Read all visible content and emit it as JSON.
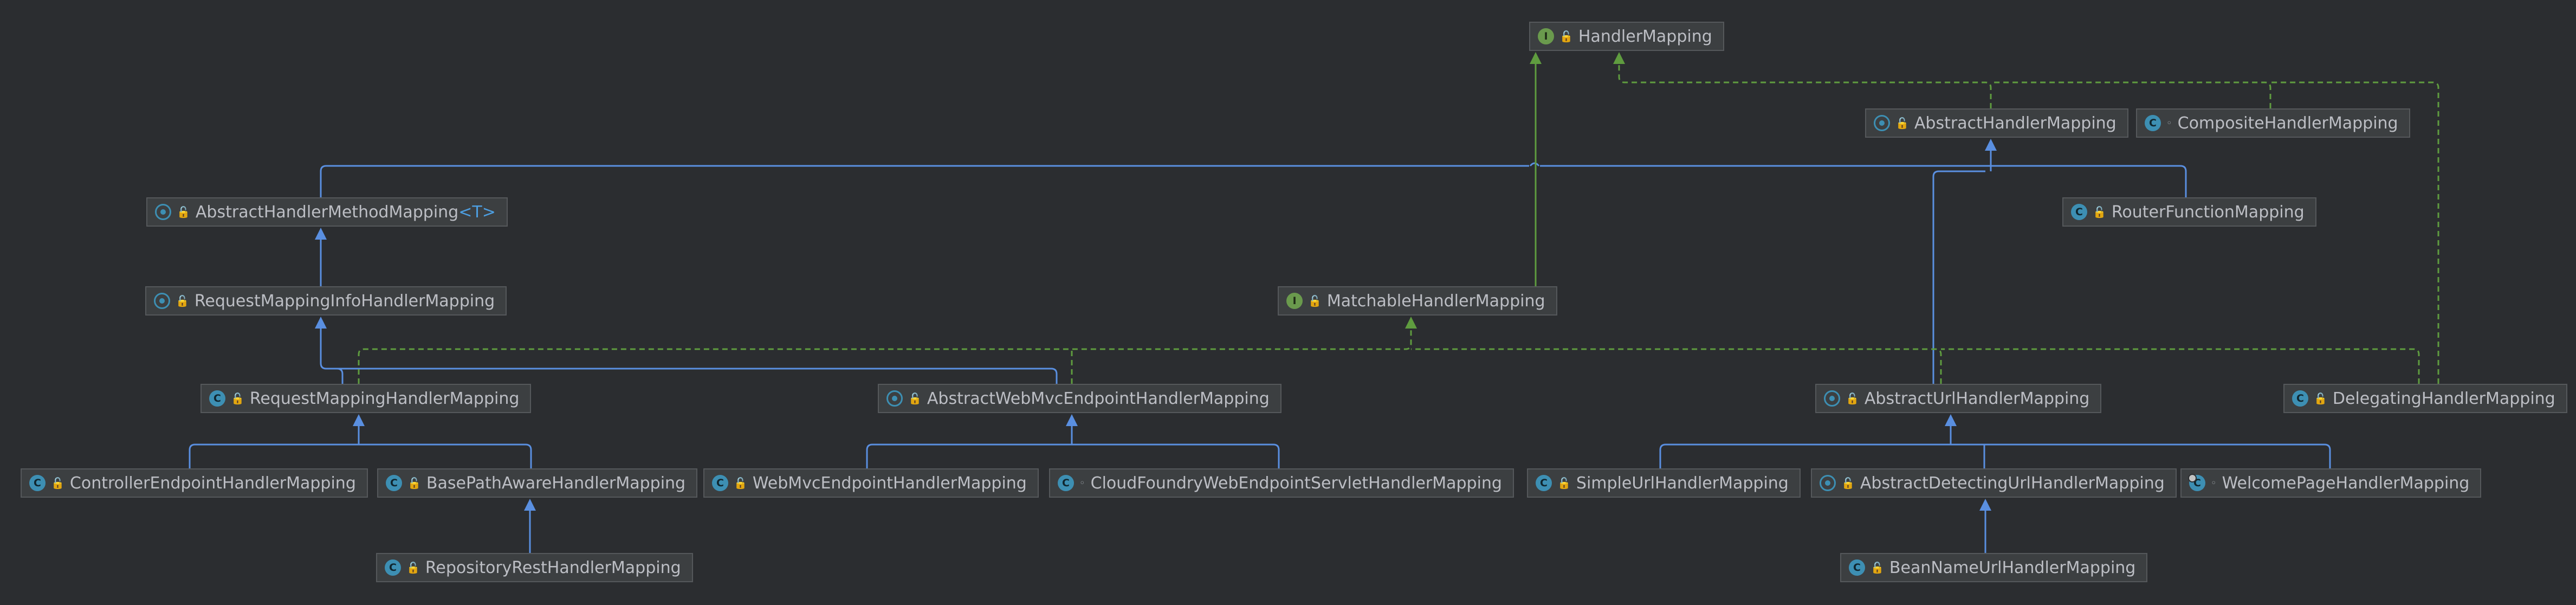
{
  "nodes": [
    {
      "id": "hm",
      "name": "HandlerMapping",
      "kind": "I",
      "vis": "pub"
    },
    {
      "id": "ahm",
      "name": "AbstractHandlerMapping",
      "kind": "A",
      "vis": "pub"
    },
    {
      "id": "chm",
      "name": "CompositeHandlerMapping",
      "kind": "C",
      "vis": "pkg"
    },
    {
      "id": "ahmm",
      "name": "AbstractHandlerMethodMapping",
      "kind": "A",
      "vis": "pub",
      "type_param": "T"
    },
    {
      "id": "rfm",
      "name": "RouterFunctionMapping",
      "kind": "C",
      "vis": "pub"
    },
    {
      "id": "rmihm",
      "name": "RequestMappingInfoHandlerMapping",
      "kind": "A",
      "vis": "pub"
    },
    {
      "id": "mhm",
      "name": "MatchableHandlerMapping",
      "kind": "I",
      "vis": "pub"
    },
    {
      "id": "rmhm",
      "name": "RequestMappingHandlerMapping",
      "kind": "C",
      "vis": "pub"
    },
    {
      "id": "awmehm",
      "name": "AbstractWebMvcEndpointHandlerMapping",
      "kind": "A",
      "vis": "pub"
    },
    {
      "id": "auhm",
      "name": "AbstractUrlHandlerMapping",
      "kind": "A",
      "vis": "pub"
    },
    {
      "id": "dhm",
      "name": "DelegatingHandlerMapping",
      "kind": "C",
      "vis": "pub"
    },
    {
      "id": "cehm",
      "name": "ControllerEndpointHandlerMapping",
      "kind": "C",
      "vis": "pub"
    },
    {
      "id": "bpahm",
      "name": "BasePathAwareHandlerMapping",
      "kind": "C",
      "vis": "pub"
    },
    {
      "id": "wmehm",
      "name": "WebMvcEndpointHandlerMapping",
      "kind": "C",
      "vis": "pub"
    },
    {
      "id": "cfwehm",
      "name": "CloudFoundryWebEndpointServletHandlerMapping",
      "kind": "C",
      "vis": "pkg"
    },
    {
      "id": "suhm",
      "name": "SimpleUrlHandlerMapping",
      "kind": "C",
      "vis": "pub"
    },
    {
      "id": "aduhm",
      "name": "AbstractDetectingUrlHandlerMapping",
      "kind": "A",
      "vis": "pub"
    },
    {
      "id": "wphm",
      "name": "WelcomePageHandlerMapping",
      "kind": "ST",
      "vis": "pkg"
    },
    {
      "id": "rrhm",
      "name": "RepositoryRestHandlerMapping",
      "kind": "C",
      "vis": "pub"
    },
    {
      "id": "bnuhm",
      "name": "BeanNameUrlHandlerMapping",
      "kind": "C",
      "vis": "pub"
    }
  ],
  "edges": [
    {
      "from": "ahm",
      "to": "hm",
      "type": "implements"
    },
    {
      "from": "chm",
      "to": "hm",
      "type": "implements"
    },
    {
      "from": "dhm",
      "to": "hm",
      "type": "implements"
    },
    {
      "from": "mhm",
      "to": "hm",
      "type": "extends_interface"
    },
    {
      "from": "ahmm",
      "to": "ahm",
      "type": "extends"
    },
    {
      "from": "rfm",
      "to": "ahm",
      "type": "extends"
    },
    {
      "from": "auhm",
      "to": "ahm",
      "type": "extends"
    },
    {
      "from": "rmihm",
      "to": "ahmm",
      "type": "extends"
    },
    {
      "from": "rmhm",
      "to": "rmihm",
      "type": "extends"
    },
    {
      "from": "awmehm",
      "to": "rmihm",
      "type": "extends"
    },
    {
      "from": "rmhm",
      "to": "mhm",
      "type": "implements"
    },
    {
      "from": "awmehm",
      "to": "mhm",
      "type": "implements"
    },
    {
      "from": "auhm",
      "to": "mhm",
      "type": "implements"
    },
    {
      "from": "cehm",
      "to": "rmhm",
      "type": "extends"
    },
    {
      "from": "bpahm",
      "to": "rmhm",
      "type": "extends"
    },
    {
      "from": "rrhm",
      "to": "bpahm",
      "type": "extends"
    },
    {
      "from": "wmehm",
      "to": "awmehm",
      "type": "extends"
    },
    {
      "from": "cfwehm",
      "to": "awmehm",
      "type": "extends"
    },
    {
      "from": "suhm",
      "to": "auhm",
      "type": "extends"
    },
    {
      "from": "aduhm",
      "to": "auhm",
      "type": "extends"
    },
    {
      "from": "wphm",
      "to": "auhm",
      "type": "extends"
    },
    {
      "from": "bnuhm",
      "to": "aduhm",
      "type": "extends"
    }
  ],
  "colors": {
    "extends": "#5a8fe0",
    "implements": "#5f9c3f",
    "background": "#2b2d30",
    "node_fill": "#3c3f41",
    "node_border": "#55585b",
    "text": "#bcbec4"
  },
  "icons": {
    "I": "interface-icon",
    "C": "class-icon",
    "A": "abstract-class-icon",
    "ST": "static-class-icon"
  }
}
